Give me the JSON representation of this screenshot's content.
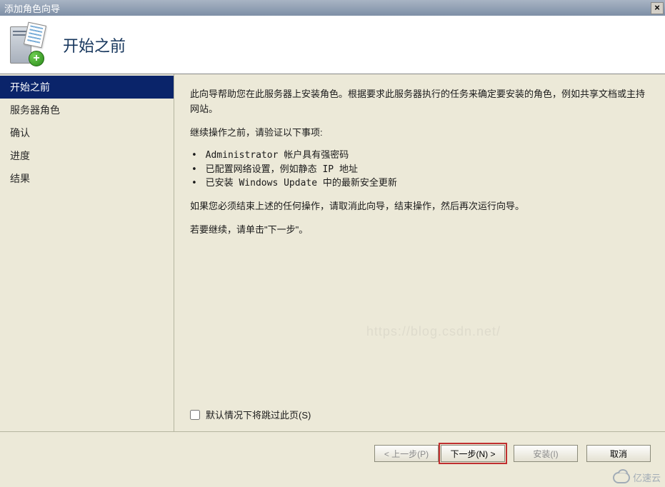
{
  "window": {
    "title": "添加角色向导",
    "close_label": "×"
  },
  "header": {
    "title": "开始之前",
    "plus": "+"
  },
  "sidebar": {
    "items": [
      {
        "label": "开始之前",
        "active": true
      },
      {
        "label": "服务器角色",
        "active": false
      },
      {
        "label": "确认",
        "active": false
      },
      {
        "label": "进度",
        "active": false
      },
      {
        "label": "结果",
        "active": false
      }
    ]
  },
  "content": {
    "intro": "此向导帮助您在此服务器上安装角色。根据要求此服务器执行的任务来确定要安装的角色，例如共享文档或主持网站。",
    "verify_heading": "继续操作之前，请验证以下事项:",
    "bullets": [
      "Administrator 帐户具有强密码",
      "已配置网络设置，例如静态 IP 地址",
      "已安装 Windows Update 中的最新安全更新"
    ],
    "cancel_note": "如果您必须结束上述的任何操作，请取消此向导，结束操作，然后再次运行向导。",
    "continue_note": "若要继续，请单击\"下一步\"。",
    "skip_label": "默认情况下将跳过此页(S)"
  },
  "footer": {
    "prev": "< 上一步(P)",
    "next": "下一步(N) >",
    "install": "安装(I)",
    "cancel": "取消"
  },
  "watermark": {
    "text": "亿速云"
  }
}
